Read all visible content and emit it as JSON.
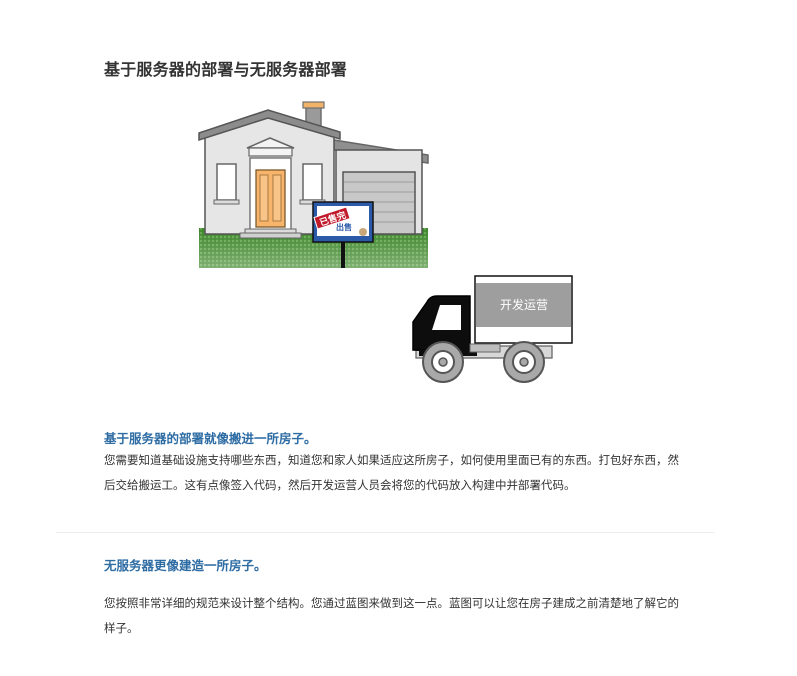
{
  "page": {
    "title": "基于服务器的部署与无服务器部署"
  },
  "illustration": {
    "sold_sign_text": "已售完",
    "sign_board_text": "出售",
    "truck_cargo_label": "开发运营"
  },
  "sections": [
    {
      "heading": "基于服务器的部署就像搬进一所房子。",
      "body": "您需要知道基础设施支持哪些东西，知道您和家人如果适应这所房子，如何使用里面已有的东西。打包好东西，然后交给搬运工。这有点像签入代码，然后开发运营人员会将您的代码放入构建中并部署代码。"
    },
    {
      "heading": "无服务器更像建造一所房子。",
      "body": "您按照非常详细的规范来设计整个结构。您通过蓝图来做到这一点。蓝图可以让您在房子建成之前清楚地了解它的样子。"
    }
  ],
  "colors": {
    "heading_blue": "#2e6ca4",
    "grass_green": "#3f8a2c",
    "sign_blue": "#2a5aa8",
    "sold_red": "#c0192a",
    "door_orange": "#f7b46a"
  }
}
